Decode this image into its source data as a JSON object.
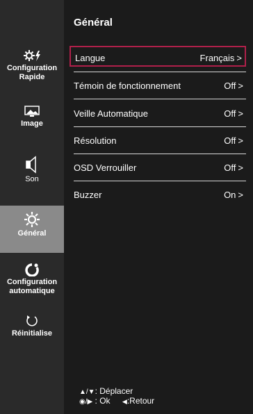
{
  "sidebar": {
    "items": [
      {
        "label_line1": "Configuration",
        "label_line2": "Rapide",
        "icon": "quick-settings-icon"
      },
      {
        "label_line1": "Image",
        "label_line2": "",
        "icon": "image-icon"
      },
      {
        "label_line1": "Son",
        "label_line2": "",
        "icon": "speaker-icon"
      },
      {
        "label_line1": "Général",
        "label_line2": "",
        "icon": "gear-icon"
      },
      {
        "label_line1": "Configuration",
        "label_line2": "automatique",
        "icon": "auto-config-icon"
      },
      {
        "label_line1": "Réinitialise",
        "label_line2": "",
        "icon": "reset-icon"
      }
    ],
    "active_index": 3
  },
  "main": {
    "title": "Général",
    "rows": [
      {
        "label": "Langue",
        "value": "Français",
        "chevron": ">"
      },
      {
        "label": "Témoin de fonctionnement",
        "value": "Off",
        "chevron": ">"
      },
      {
        "label": "Veille Automatique",
        "value": "Off",
        "chevron": ">"
      },
      {
        "label": "Résolution",
        "value": "Off",
        "chevron": ">"
      },
      {
        "label": "OSD Verrouiller",
        "value": "Off",
        "chevron": ">"
      },
      {
        "label": "Buzzer",
        "value": "On",
        "chevron": ">"
      }
    ],
    "selected_index": 0
  },
  "footer": {
    "move_keys": "▲/▼",
    "move_label": ": Déplacer",
    "ok_keys": "◉/▶",
    "ok_label": ": Ok",
    "back_key": "◀",
    "back_label": ":Retour"
  },
  "colors": {
    "background": "#1b1b1b",
    "sidebar": "#2a2a2a",
    "active": "#8a8a8a",
    "highlight": "#b0204a",
    "text": "#ffffff"
  }
}
